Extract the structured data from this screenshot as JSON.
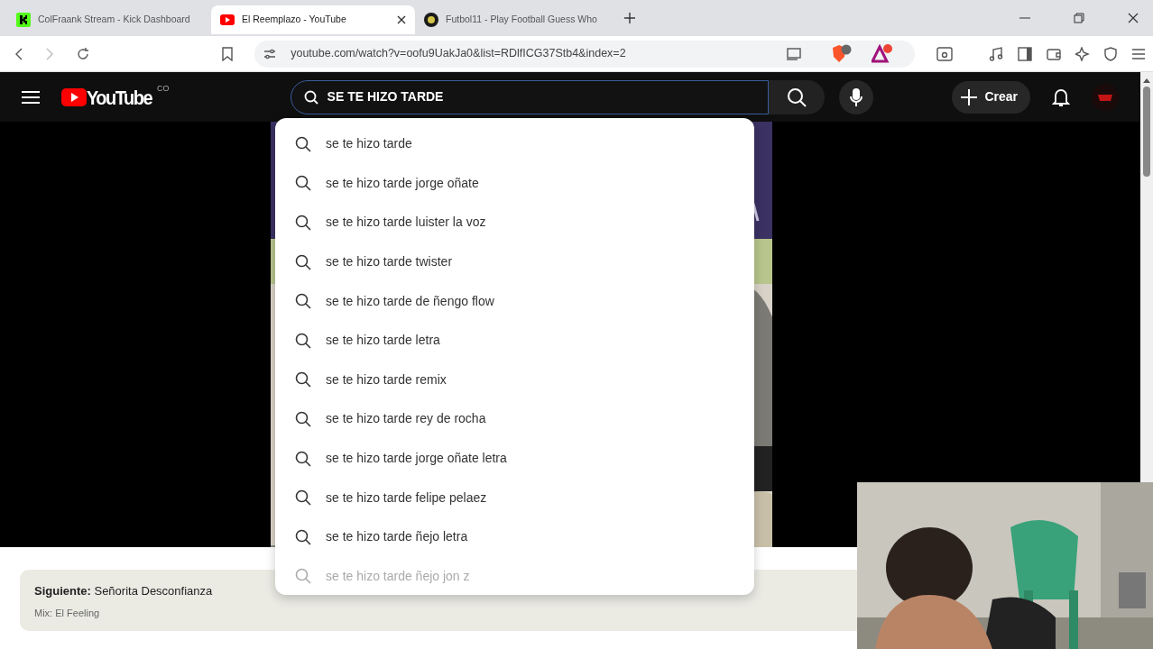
{
  "browser": {
    "tabs": [
      {
        "title": "ColFraank Stream - Kick Dashboard",
        "selected": false
      },
      {
        "title": "El Reemplazo - YouTube",
        "selected": true
      },
      {
        "title": "Futbol11 - Play Football Guess Who",
        "selected": false
      }
    ],
    "address": "youtube.com/watch?v=oofu9UakJa0&list=RDlfICG37Stb4&index=2"
  },
  "youtube": {
    "logo_text": "YouTube",
    "region": "CO",
    "search_value": "SE TE HIZO TARDE",
    "create_label": "Crear"
  },
  "suggestions": [
    {
      "text": "se te hizo tarde",
      "dimmed": false
    },
    {
      "text": "se te hizo tarde jorge oñate",
      "dimmed": false
    },
    {
      "text": "se te hizo tarde luister la voz",
      "dimmed": false
    },
    {
      "text": "se te hizo tarde twister",
      "dimmed": false
    },
    {
      "text": "se te hizo tarde de ñengo flow",
      "dimmed": false
    },
    {
      "text": "se te hizo tarde letra",
      "dimmed": false
    },
    {
      "text": "se te hizo tarde remix",
      "dimmed": false
    },
    {
      "text": "se te hizo tarde rey de rocha",
      "dimmed": false
    },
    {
      "text": "se te hizo tarde jorge oñate letra",
      "dimmed": false
    },
    {
      "text": "se te hizo tarde felipe pelaez",
      "dimmed": false
    },
    {
      "text": "se te hizo tarde ñejo letra",
      "dimmed": false
    },
    {
      "text": "se te hizo tarde ñejo jon z",
      "dimmed": true
    }
  ],
  "up_next": {
    "title": "**Siguiente:** Señorita Desconfianza",
    "mix": "Mix: El Feeling"
  }
}
